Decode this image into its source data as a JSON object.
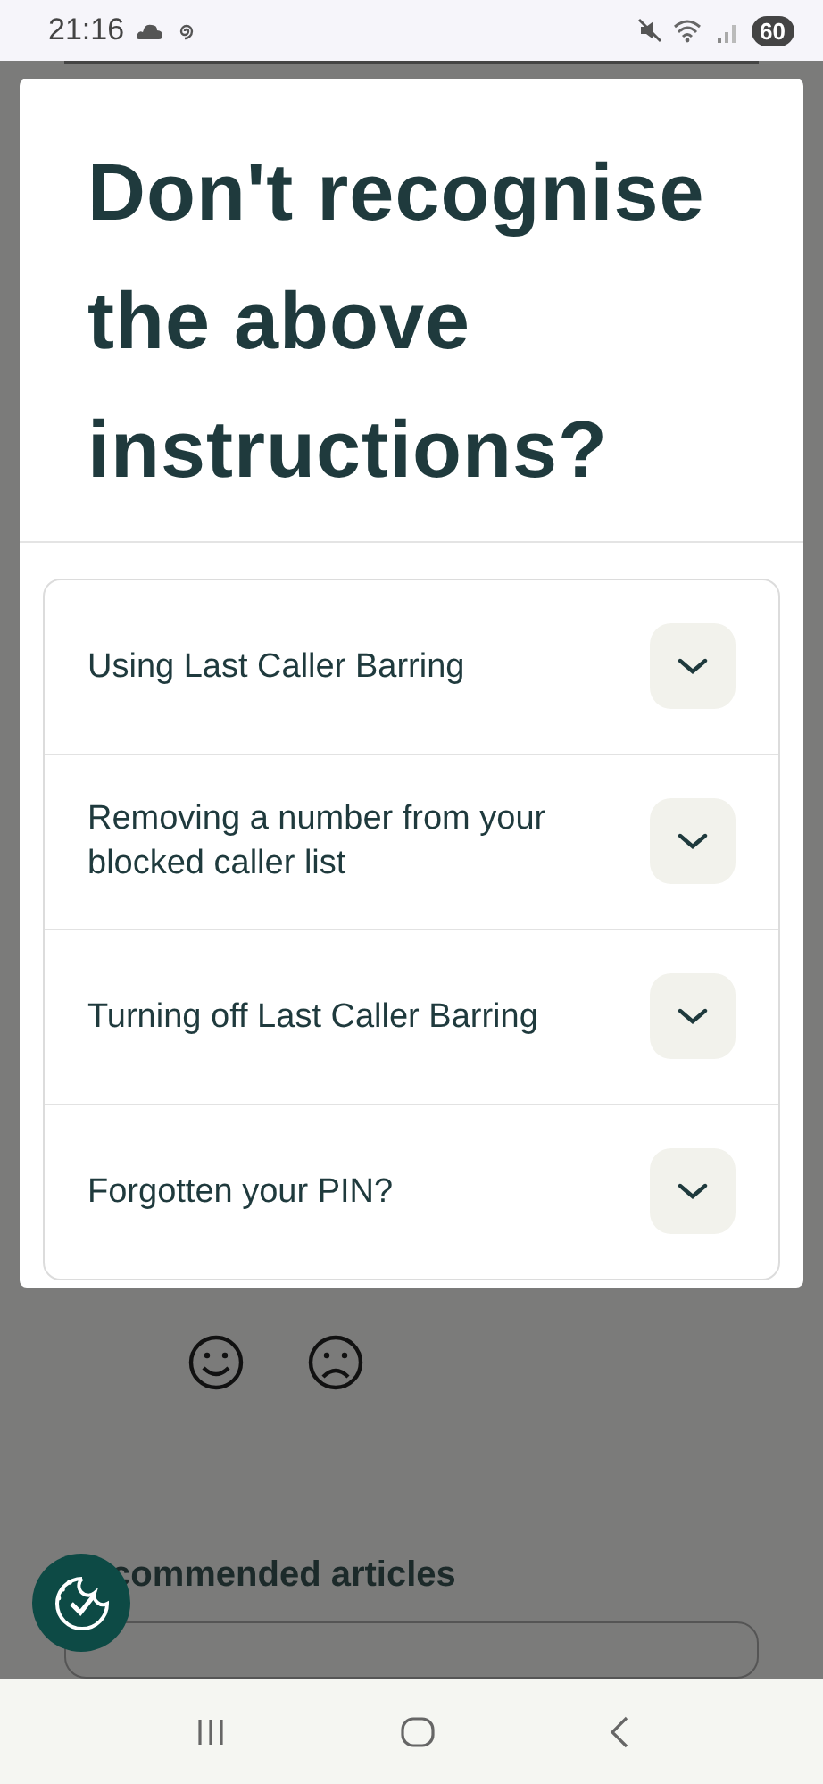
{
  "status_bar": {
    "time": "21:16",
    "battery": "60"
  },
  "modal": {
    "title": "Don't recognise the above instructions?",
    "items": [
      {
        "label": "Using Last Caller Barring",
        "expanded": false
      },
      {
        "label": "Removing a number from your blocked caller list",
        "expanded": false
      },
      {
        "label": "Turning off Last Caller Barring",
        "expanded": false
      },
      {
        "label": "Forgotten your PIN?",
        "expanded": false
      }
    ]
  },
  "background": {
    "heading": "commended articles"
  }
}
